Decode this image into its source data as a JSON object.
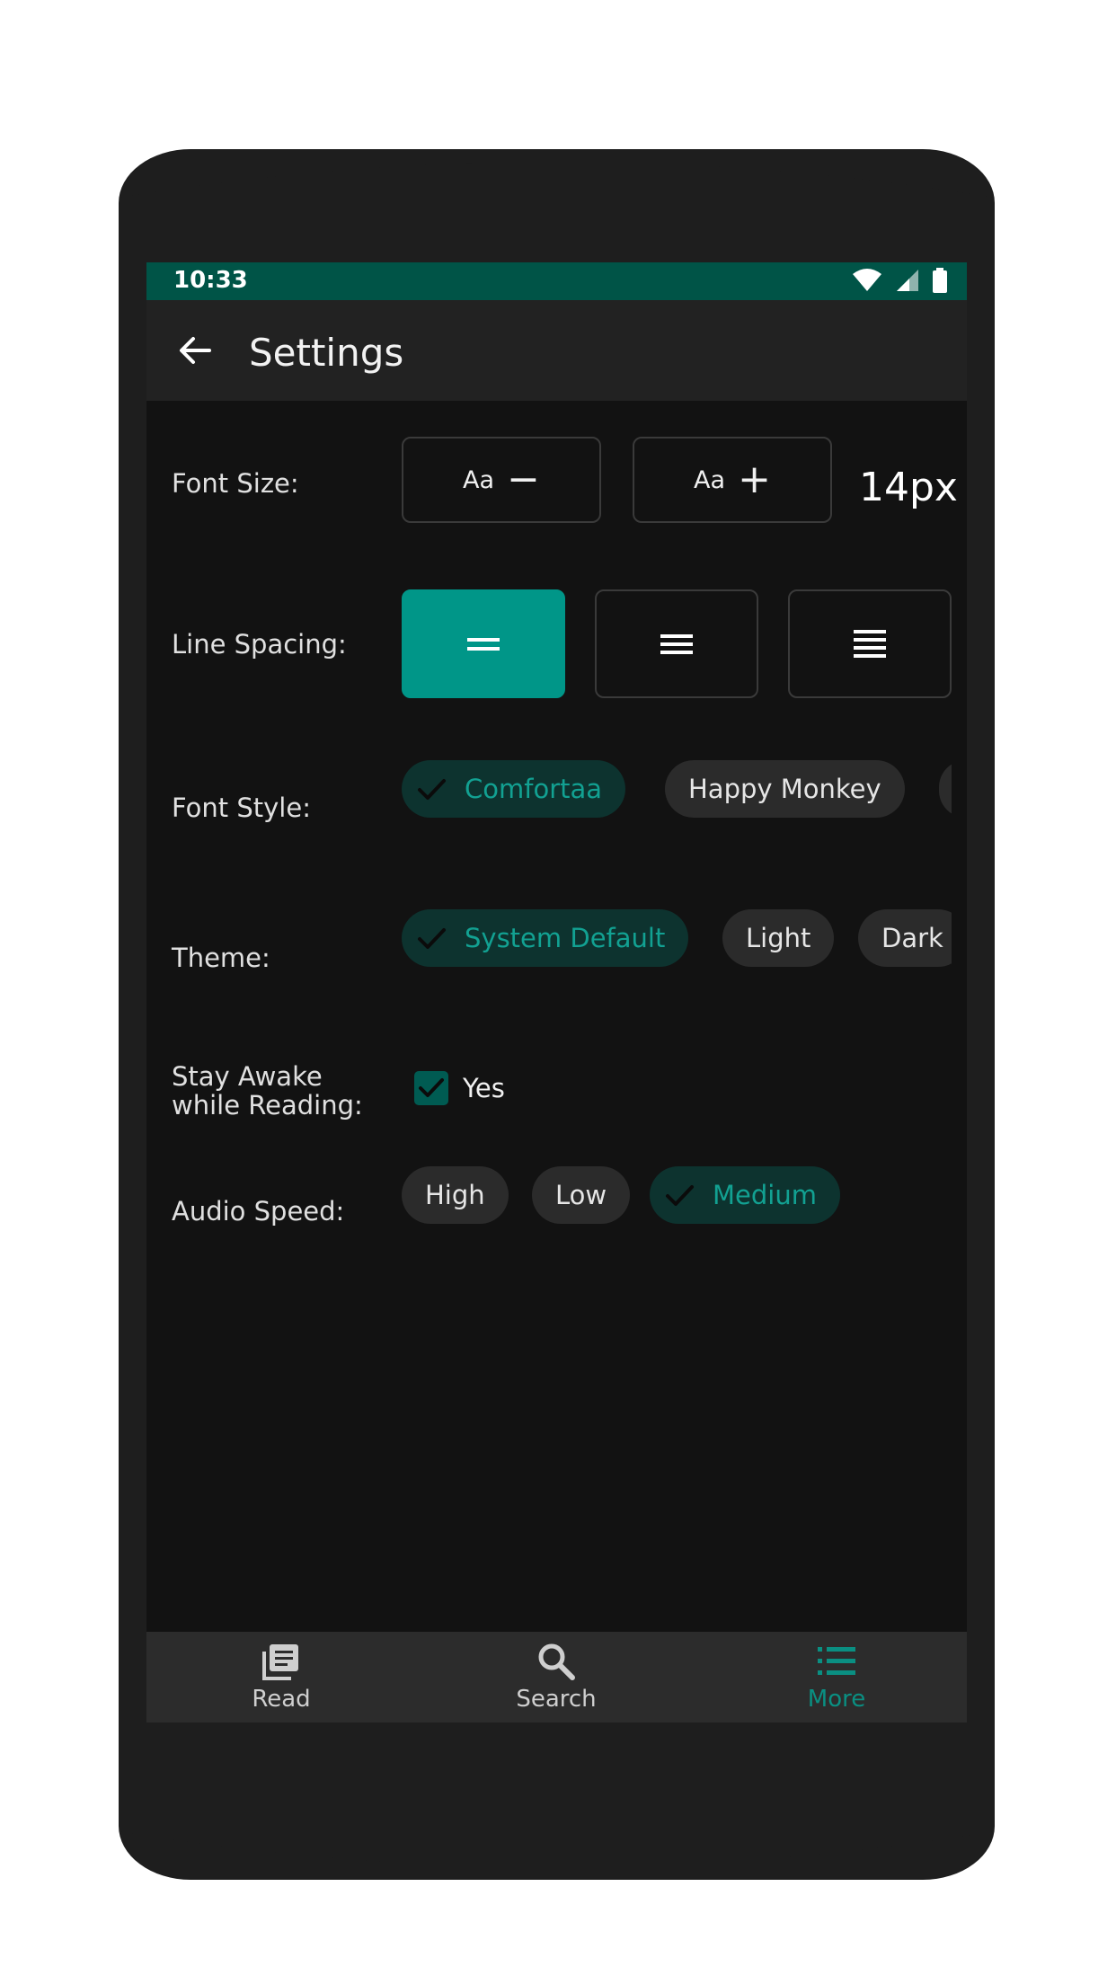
{
  "status_bar": {
    "time": "10:33"
  },
  "app_bar": {
    "title": "Settings"
  },
  "settings": {
    "font_size": {
      "label": "Font Size:",
      "decrease_text": "Aa",
      "decrease_sign": "−",
      "increase_text": "Aa",
      "increase_sign": "+",
      "value": "14px"
    },
    "line_spacing": {
      "label": "Line Spacing:",
      "selected_index": 0
    },
    "font_style": {
      "label": "Font Style:",
      "options": [
        "Comfortaa",
        "Happy Monkey"
      ],
      "selected": "Comfortaa"
    },
    "theme": {
      "label": "Theme:",
      "options": [
        "System Default",
        "Light",
        "Dark"
      ],
      "selected": "System Default"
    },
    "stay_awake": {
      "label_line1": "Stay Awake",
      "label_line2": "while Reading:",
      "checked": true,
      "option_label": "Yes"
    },
    "audio_speed": {
      "label": "Audio Speed:",
      "options": [
        "High",
        "Low",
        "Medium"
      ],
      "selected": "Medium"
    }
  },
  "bottom_nav": {
    "items": [
      {
        "label": "Read",
        "icon": "library-icon"
      },
      {
        "label": "Search",
        "icon": "search-icon"
      },
      {
        "label": "More",
        "icon": "list-icon"
      }
    ],
    "active": "More"
  },
  "colors": {
    "accent": "#009688",
    "status_bar": "#005447",
    "background": "#121212",
    "chip_selected_bg": "#0d332f",
    "chip_selected_text": "#12a192"
  }
}
